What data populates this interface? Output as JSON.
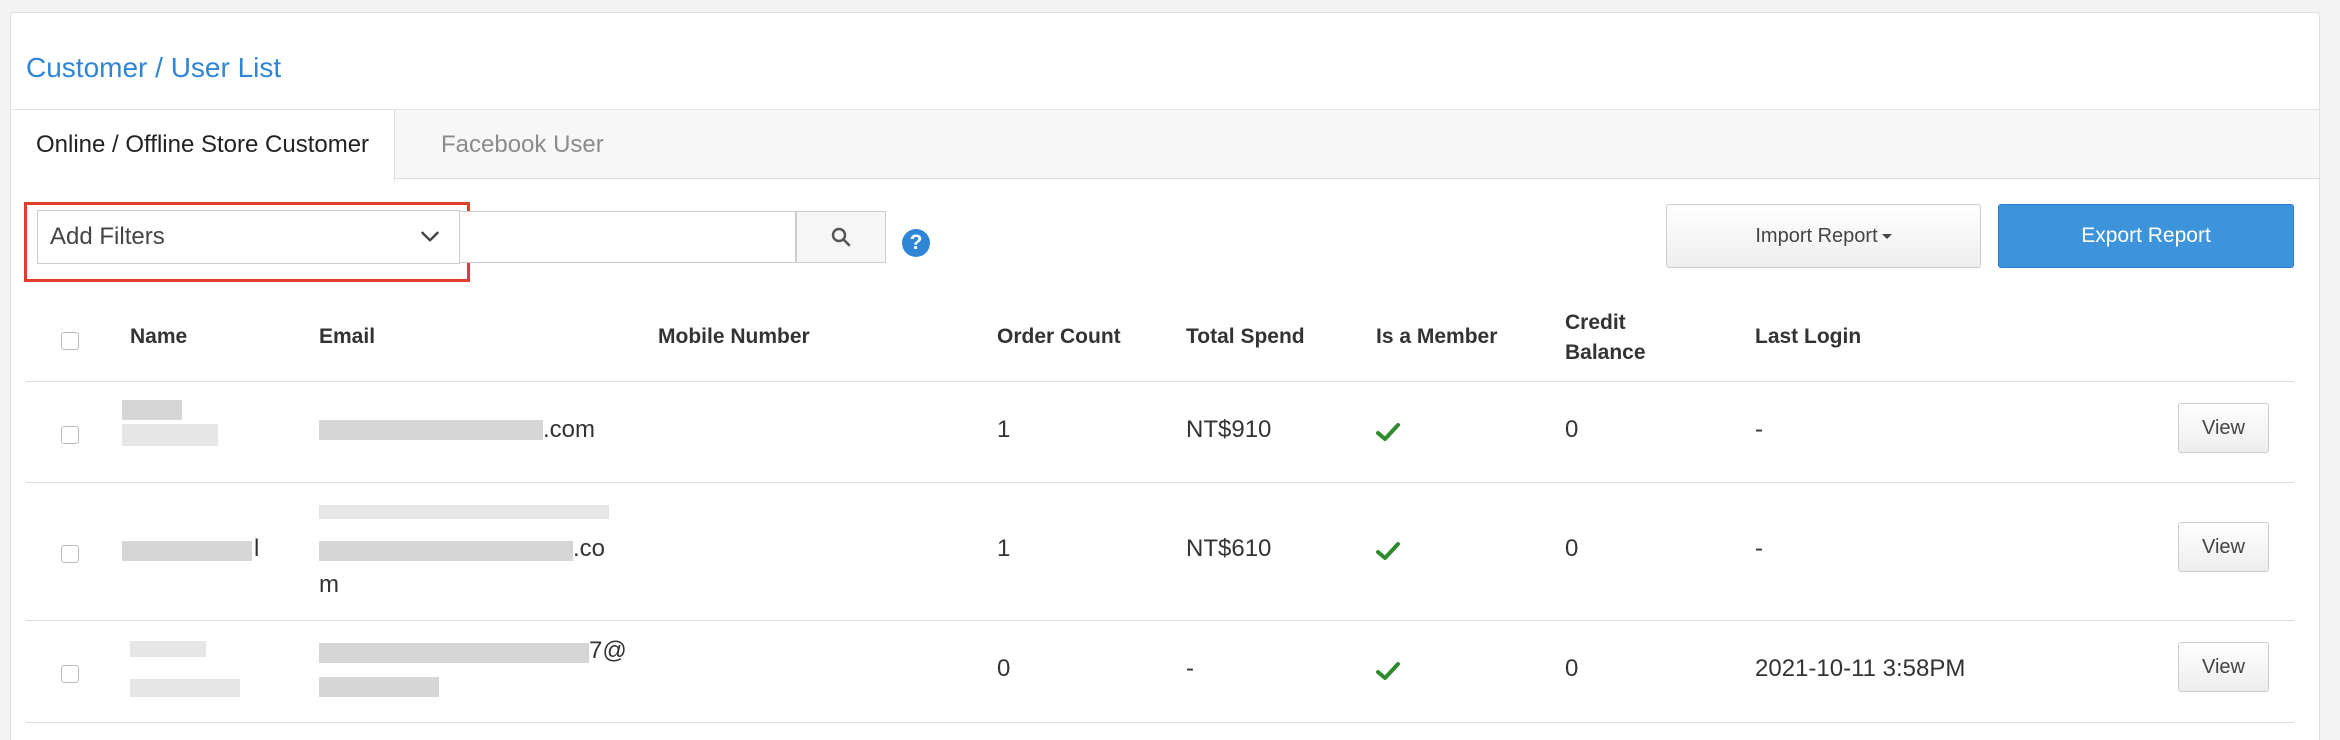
{
  "page": {
    "title": "Customer / User List"
  },
  "tabs": [
    {
      "label": "Online / Offline Store Customer",
      "active": true
    },
    {
      "label": "Facebook User",
      "active": false
    }
  ],
  "filters": {
    "select_label": "Add Filters",
    "search_value": ""
  },
  "toolbar": {
    "import_label": "Import Report",
    "export_label": "Export Report"
  },
  "colors": {
    "accent": "#2f86d6",
    "highlight": "#e0402a",
    "check": "#2e8b2e"
  },
  "table": {
    "headers": {
      "name": "Name",
      "email": "Email",
      "mobile": "Mobile Number",
      "order_count": "Order Count",
      "total_spend": "Total Spend",
      "is_member": "Is a Member",
      "credit_balance_1": "Credit",
      "credit_balance_2": "Balance",
      "last_login": "Last Login"
    },
    "rows": [
      {
        "email_visible": ".com",
        "email_line2": "",
        "email_line3": "",
        "name_visible": "",
        "mobile": "",
        "order_count": "1",
        "total_spend": "NT$910",
        "is_member": "check-icon",
        "credit_balance": "0",
        "last_login": "-",
        "action": "View"
      },
      {
        "email_visible": "",
        "email_line2": ".co",
        "email_line3": "m",
        "name_visible": "l",
        "mobile": "",
        "order_count": "1",
        "total_spend": "NT$610",
        "is_member": "check-icon",
        "credit_balance": "0",
        "last_login": "-",
        "action": "View"
      },
      {
        "email_visible": "7@",
        "email_line2": "",
        "email_line3": "",
        "name_visible": "",
        "mobile": "",
        "order_count": "0",
        "total_spend": "-",
        "is_member": "check-icon",
        "credit_balance": "0",
        "last_login": "2021-10-11 3:58PM",
        "action": "View"
      }
    ]
  }
}
